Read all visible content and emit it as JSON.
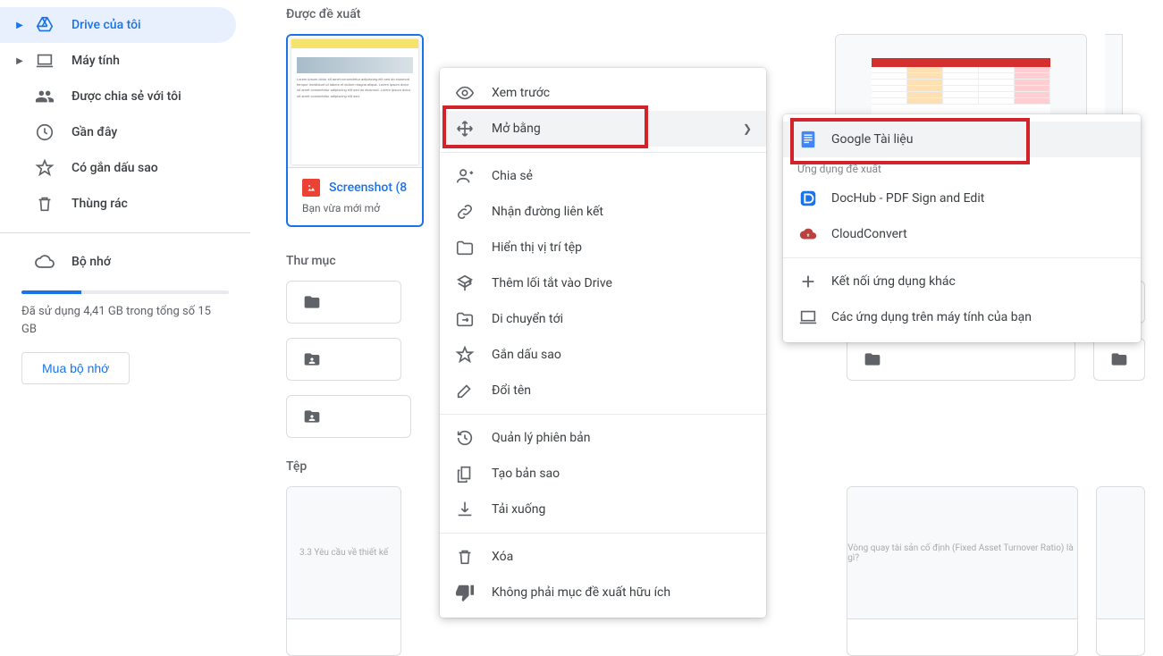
{
  "sidebar": {
    "nav": [
      {
        "id": "my-drive",
        "label": "Drive của tôi",
        "icon": "drive",
        "expandable": true,
        "active": true
      },
      {
        "id": "computers",
        "label": "Máy tính",
        "icon": "laptop",
        "expandable": true
      },
      {
        "id": "shared",
        "label": "Được chia sẻ với tôi",
        "icon": "people"
      },
      {
        "id": "recent",
        "label": "Gần đây",
        "icon": "clock"
      },
      {
        "id": "starred",
        "label": "Có gắn dấu sao",
        "icon": "star"
      },
      {
        "id": "trash",
        "label": "Thùng rác",
        "icon": "trash"
      }
    ],
    "storage_label": "Bộ nhớ",
    "storage_text": "Đã sử dụng 4,41 GB trong tổng số 15 GB",
    "buy_label": "Mua bộ nhớ"
  },
  "sections": {
    "suggested": "Được đề xuất",
    "folders": "Thư mục",
    "files": "Tệp"
  },
  "suggested_card": {
    "name": "Screenshot (8",
    "sub": "Bạn vừa mới mở"
  },
  "context_menu": {
    "preview": "Xem trước",
    "open_with": "Mở bằng",
    "share": "Chia sẻ",
    "get_link": "Nhận đường liên kết",
    "show_location": "Hiển thị vị trí tệp",
    "add_shortcut": "Thêm lối tắt vào Drive",
    "move_to": "Di chuyển tới",
    "star": "Gắn dấu sao",
    "rename": "Đổi tên",
    "versions": "Quản lý phiên bản",
    "make_copy": "Tạo bản sao",
    "download": "Tải xuống",
    "remove": "Xóa",
    "not_helpful": "Không phải mục đề xuất hữu ích"
  },
  "submenu": {
    "docs": "Google Tài liệu",
    "apps_label": "Ứng dụng đề xuất",
    "dochub": "DocHub - PDF Sign and Edit",
    "cloudconvert": "CloudConvert",
    "connect_more": "Kết nối ứng dụng khác",
    "desktop_apps": "Các ứng dụng trên máy tính của bạn"
  }
}
